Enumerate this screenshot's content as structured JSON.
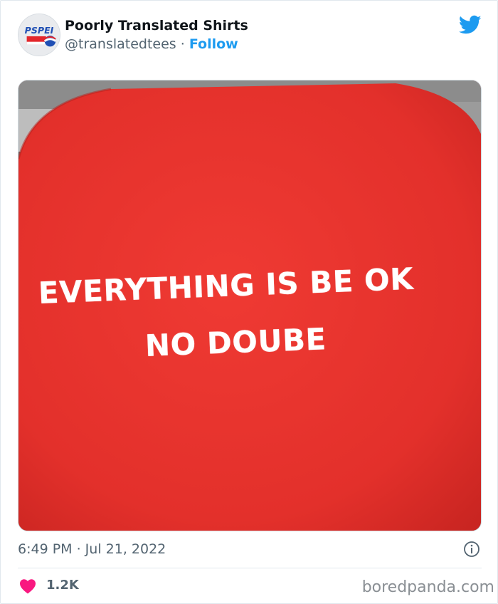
{
  "tweet": {
    "author": {
      "display_name": "Poorly Translated Shirts",
      "handle": "@translatedtees",
      "separator": "·",
      "follow_label": "Follow",
      "avatar_icon": "pepsi-parody-logo-icon",
      "avatar_text": "PSPEI"
    },
    "platform_icon": "twitter-bird-icon",
    "media": {
      "shirt_text_line1": "EVERYTHING IS BE OK",
      "shirt_text_line2": "NO DOUBE",
      "shirt_color": "#e7322c"
    },
    "timestamp": "6:49 PM · Jul 21, 2022",
    "info_icon": "info-icon",
    "likes": {
      "icon": "heart-icon",
      "count": "1.2K",
      "color": "#f91880"
    }
  },
  "watermark": "boredpanda.com",
  "colors": {
    "twitter_blue": "#1d9bf0",
    "secondary_text": "#536471"
  }
}
